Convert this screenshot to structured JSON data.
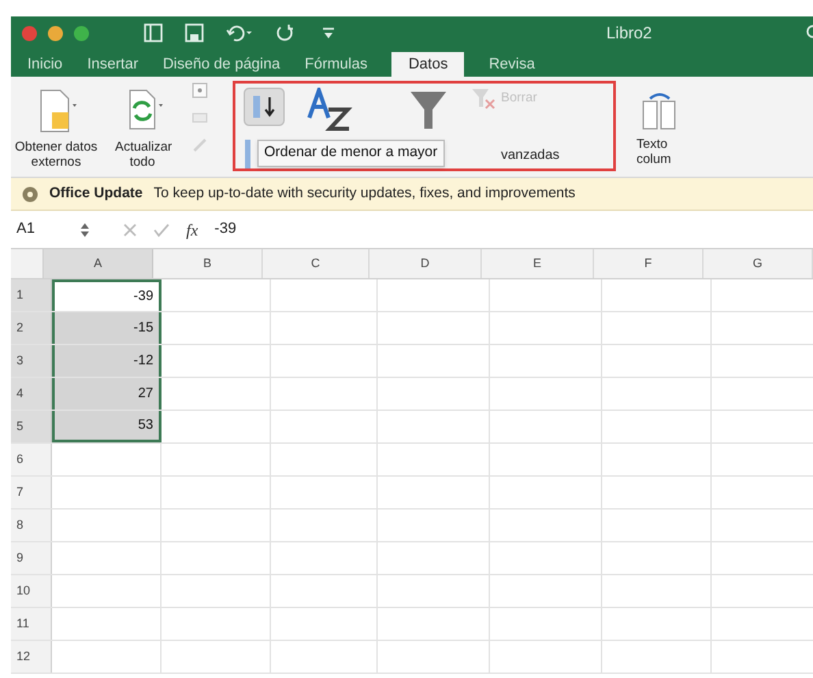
{
  "window": {
    "title": "Libro2"
  },
  "tabs": [
    {
      "label": "Inicio",
      "selected": false
    },
    {
      "label": "Insertar",
      "selected": false
    },
    {
      "label": "Diseño de página",
      "selected": false
    },
    {
      "label": "Fórmulas",
      "selected": false
    },
    {
      "label": "Datos",
      "selected": true
    },
    {
      "label": "Revisa",
      "selected": false
    }
  ],
  "ribbon": {
    "get_data": "Obtener datos externos",
    "refresh": "Actualizar todo",
    "sort_ascending": {
      "pressed": true
    },
    "clear": {
      "label": "Borrar",
      "disabled": true
    },
    "advanced": "vanzadas",
    "text_to_columns": "Texto colum",
    "tooltip": "Ordenar de menor a mayor",
    "highlighted": true
  },
  "update_bar": {
    "title": "Office Update",
    "message": "To keep up-to-date with security updates, fixes, and improvements"
  },
  "formula_bar": {
    "name_box": "A1",
    "fx": "fx",
    "value": "-39"
  },
  "columns": [
    "A",
    "B",
    "C",
    "D",
    "E",
    "F",
    "G"
  ],
  "rows": [
    {
      "number": "1",
      "value": "-39",
      "selected": true,
      "active": true
    },
    {
      "number": "2",
      "value": "-15",
      "selected": true,
      "active": false
    },
    {
      "number": "3",
      "value": "-12",
      "selected": true,
      "active": false
    },
    {
      "number": "4",
      "value": "27",
      "selected": true,
      "active": false
    },
    {
      "number": "5",
      "value": "53",
      "selected": true,
      "active": false
    },
    {
      "number": "6",
      "selected": false,
      "active": false
    },
    {
      "number": "7",
      "selected": false,
      "active": false
    },
    {
      "number": "8",
      "selected": false,
      "active": false
    },
    {
      "number": "9",
      "selected": false,
      "active": false
    },
    {
      "number": "10",
      "selected": false,
      "active": false
    },
    {
      "number": "11",
      "selected": false,
      "active": false
    },
    {
      "number": "12",
      "selected": false,
      "active": false
    }
  ]
}
